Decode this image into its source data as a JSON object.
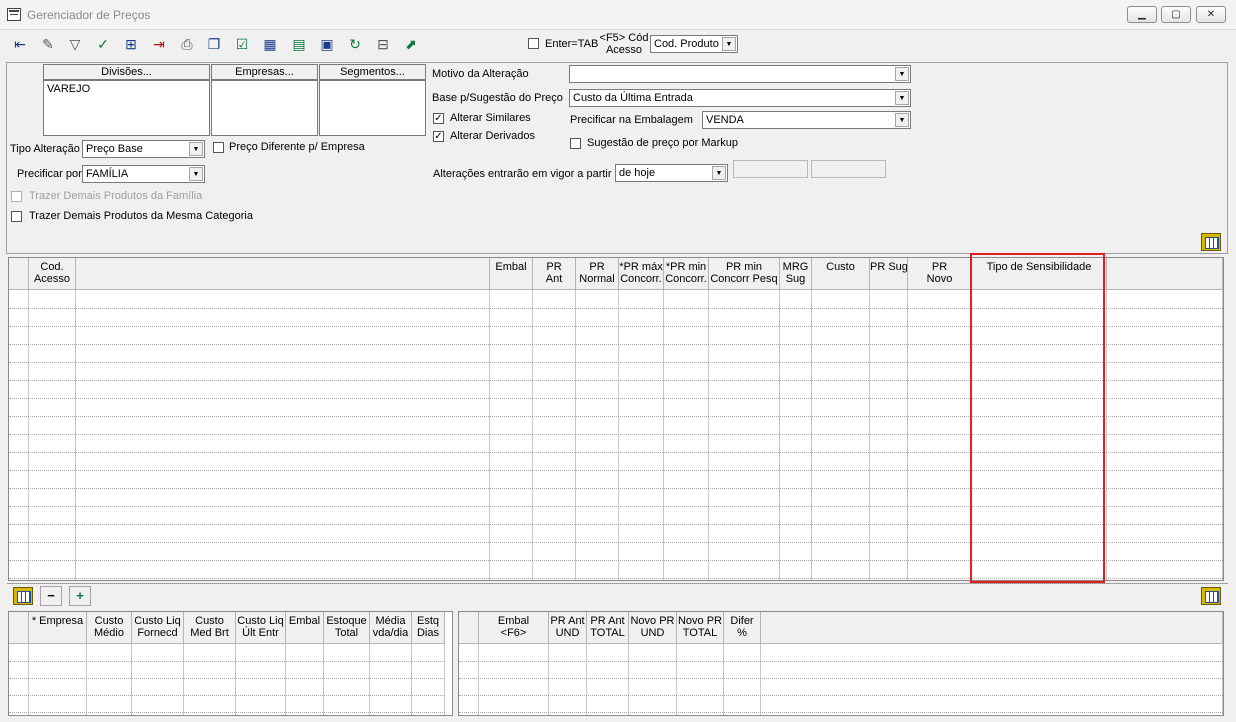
{
  "window": {
    "title": "Gerenciador de Preços",
    "controls": [
      "▁",
      "▢",
      "✕"
    ]
  },
  "toolbar": {
    "buttons": [
      "exit-icon",
      "eraser-icon",
      "filter-icon",
      "filter-check-icon",
      "add-item-icon",
      "export-item-icon",
      "print-icon",
      "copy-icon",
      "checklist-icon",
      "calendar-grid-icon",
      "spreadsheet-icon",
      "save-icon",
      "refresh-icon",
      "calculator-icon",
      "chart-icon"
    ],
    "enter_tab_label": "Enter=TAB",
    "f5_label": "<F5> Cód Acesso",
    "f5_line1": "<F5> Cód",
    "f5_line2": "Acesso",
    "cod_acesso_value": "Cod. Produto"
  },
  "selection": {
    "divisoes_header": "Divisões...",
    "empresas_header": "Empresas...",
    "segmentos_header": "Segmentos...",
    "divisoes_items": [
      "VAREJO"
    ]
  },
  "form": {
    "tipo_alteracao_label": "Tipo Alteração",
    "tipo_alteracao_value": "Preço Base",
    "preco_diferente_label": "Preço Diferente p/ Empresa",
    "precificar_por_label": "Precificar por",
    "precificar_por_value": "FAMÍLIA",
    "trazer_familia_label": "Trazer Demais Produtos da Família",
    "trazer_categoria_label": "Trazer Demais Produtos da Mesma Categoria",
    "motivo_label": "Motivo da Alteração",
    "motivo_value": "",
    "base_sugestao_label": "Base p/Sugestão do Preço",
    "base_sugestao_value": "Custo da Última Entrada",
    "alterar_similares_label": "Alterar Similares",
    "alterar_similares_checked": true,
    "alterar_derivados_label": "Alterar Derivados",
    "alterar_derivados_checked": true,
    "precificar_embalagem_label": "Precificar na Embalagem",
    "precificar_embalagem_value": "VENDA",
    "sugestao_markup_label": "Sugestão de preço por Markup",
    "alteracoes_vigor_label": "Alterações entrarão em vigor a partir",
    "alteracoes_vigor_value": "de hoje",
    "check_mark": "✓",
    "combo_arrow": "▼"
  },
  "main_grid": {
    "columns": [
      "Cod.\nAcesso",
      "",
      "Embal",
      "PR\nAnt",
      "PR\nNormal",
      "*PR máx\nConcorr.",
      "*PR min\nConcorr.",
      "PR min\nConcorr Pesq",
      "MRG\nSug",
      "Custo",
      "PR Sug",
      "PR\nNovo",
      "Tipo de Sensibilidade",
      ""
    ]
  },
  "bottom_bar": {
    "minus": "−",
    "plus": "+"
  },
  "bottom_left_grid": {
    "columns": [
      "* Empresa",
      "Custo\nMédio",
      "Custo Liq\nFornecd",
      "Custo\nMed Brt",
      "Custo Liq\nÚlt Entr",
      "Embal",
      "Estoque\nTotal",
      "Média\nvda/dia",
      "Estq\nDias"
    ]
  },
  "bottom_right_grid": {
    "columns": [
      "Embal\n<F6>",
      "PR Ant\nUND",
      "PR Ant\nTOTAL",
      "Novo PR\nUND",
      "Novo PR\nTOTAL",
      "Difer\n%",
      ""
    ]
  },
  "colors": {
    "highlight": "#e02020",
    "window_bg": "#f0f0f0"
  }
}
